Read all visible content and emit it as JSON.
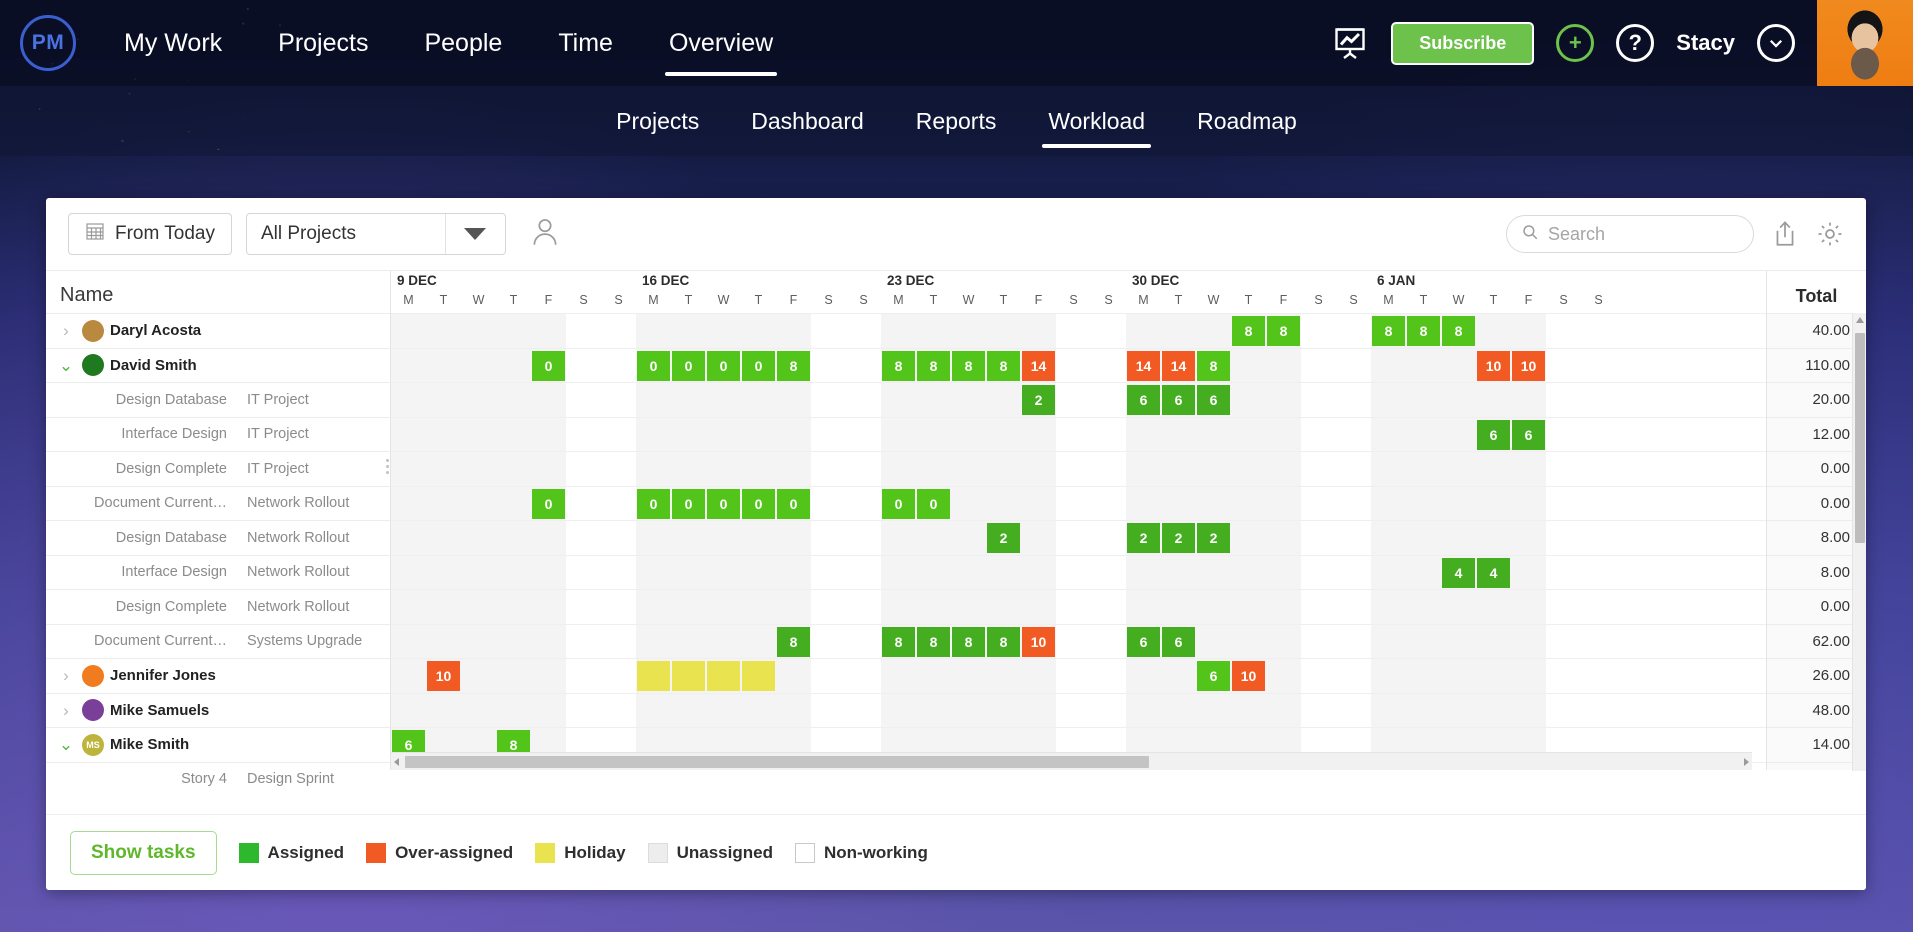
{
  "brand": {
    "logo_text": "PM"
  },
  "topnav": {
    "links": [
      {
        "label": "My Work",
        "active": false
      },
      {
        "label": "Projects",
        "active": false
      },
      {
        "label": "People",
        "active": false
      },
      {
        "label": "Time",
        "active": false
      },
      {
        "label": "Overview",
        "active": true
      }
    ],
    "presentation_icon": "presentation-chart-icon",
    "subscribe_label": "Subscribe",
    "add_icon": "plus-circle-icon",
    "help_icon": "question-circle-icon",
    "user_name": "Stacy",
    "user_caret_icon": "chevron-down-circle-icon",
    "avatar": "user-photo-avatar"
  },
  "subnav": {
    "tabs": [
      {
        "label": "Projects",
        "active": false
      },
      {
        "label": "Dashboard",
        "active": false
      },
      {
        "label": "Reports",
        "active": false
      },
      {
        "label": "Workload",
        "active": true
      },
      {
        "label": "Roadmap",
        "active": false
      }
    ]
  },
  "toolbar": {
    "date_button": "From Today",
    "date_icon": "calendar-icon",
    "project_filter_value": "All Projects",
    "person_filter_icon": "person-filter-icon",
    "search_placeholder": "Search",
    "search_value": "",
    "search_icon": "search-icon",
    "export_icon": "share-export-icon",
    "settings_icon": "gear-icon"
  },
  "grid": {
    "name_header": "Name",
    "total_header": "Total",
    "weeks": [
      {
        "label": "9 DEC",
        "days": [
          "M",
          "T",
          "W",
          "T",
          "F",
          "S",
          "S"
        ]
      },
      {
        "label": "16 DEC",
        "days": [
          "M",
          "T",
          "W",
          "T",
          "F",
          "S",
          "S"
        ]
      },
      {
        "label": "23 DEC",
        "days": [
          "M",
          "T",
          "W",
          "T",
          "F",
          "S",
          "S"
        ]
      },
      {
        "label": "30 DEC",
        "days": [
          "M",
          "T",
          "W",
          "T",
          "F",
          "S",
          "S"
        ]
      },
      {
        "label": "6 JAN",
        "days": [
          "M",
          "T",
          "W",
          "T",
          "F",
          "S",
          "S"
        ]
      }
    ],
    "day_width": 35,
    "rows": [
      {
        "type": "person",
        "name": "Daryl Acosta",
        "expanded": false,
        "avatar_color": "#b8893f",
        "total": "40.00",
        "cells": [
          {
            "d": 24,
            "v": "8",
            "k": "assigned"
          },
          {
            "d": 25,
            "v": "8",
            "k": "assigned"
          },
          {
            "d": 28,
            "v": "8",
            "k": "assigned"
          },
          {
            "d": 29,
            "v": "8",
            "k": "assigned"
          },
          {
            "d": 30,
            "v": "8",
            "k": "assigned"
          }
        ]
      },
      {
        "type": "person",
        "name": "David Smith",
        "expanded": true,
        "avatar_color": "#1f7a1f",
        "total": "110.00",
        "cells": [
          {
            "d": 4,
            "v": "0",
            "k": "assigned"
          },
          {
            "d": 7,
            "v": "0",
            "k": "assigned"
          },
          {
            "d": 8,
            "v": "0",
            "k": "assigned"
          },
          {
            "d": 9,
            "v": "0",
            "k": "assigned"
          },
          {
            "d": 10,
            "v": "0",
            "k": "assigned"
          },
          {
            "d": 11,
            "v": "8",
            "k": "assigned"
          },
          {
            "d": 14,
            "v": "8",
            "k": "assigned"
          },
          {
            "d": 15,
            "v": "8",
            "k": "assigned"
          },
          {
            "d": 16,
            "v": "8",
            "k": "assigned"
          },
          {
            "d": 17,
            "v": "8",
            "k": "assigned"
          },
          {
            "d": 18,
            "v": "14",
            "k": "over"
          },
          {
            "d": 21,
            "v": "14",
            "k": "over"
          },
          {
            "d": 22,
            "v": "14",
            "k": "over"
          },
          {
            "d": 23,
            "v": "8",
            "k": "assigned"
          },
          {
            "d": 31,
            "v": "10",
            "k": "over"
          },
          {
            "d": 32,
            "v": "10",
            "k": "over"
          }
        ]
      },
      {
        "type": "task",
        "name": "Design Database",
        "project": "IT Project",
        "total": "20.00",
        "cells": [
          {
            "d": 18,
            "v": "2",
            "k": "assigned-task"
          },
          {
            "d": 21,
            "v": "6",
            "k": "assigned-task"
          },
          {
            "d": 22,
            "v": "6",
            "k": "assigned-task"
          },
          {
            "d": 23,
            "v": "6",
            "k": "assigned-task"
          }
        ]
      },
      {
        "type": "task",
        "name": "Interface Design",
        "project": "IT Project",
        "total": "12.00",
        "cells": [
          {
            "d": 31,
            "v": "6",
            "k": "assigned-task"
          },
          {
            "d": 32,
            "v": "6",
            "k": "assigned-task"
          }
        ]
      },
      {
        "type": "task",
        "name": "Design Complete",
        "project": "IT Project",
        "total": "0.00",
        "cells": []
      },
      {
        "type": "task",
        "name": "Document Current…",
        "project": "Network Rollout",
        "total": "0.00",
        "cells": [
          {
            "d": 4,
            "v": "0",
            "k": "assigned"
          },
          {
            "d": 7,
            "v": "0",
            "k": "assigned"
          },
          {
            "d": 8,
            "v": "0",
            "k": "assigned"
          },
          {
            "d": 9,
            "v": "0",
            "k": "assigned"
          },
          {
            "d": 10,
            "v": "0",
            "k": "assigned"
          },
          {
            "d": 11,
            "v": "0",
            "k": "assigned"
          },
          {
            "d": 14,
            "v": "0",
            "k": "assigned"
          },
          {
            "d": 15,
            "v": "0",
            "k": "assigned"
          }
        ]
      },
      {
        "type": "task",
        "name": "Design Database",
        "project": "Network Rollout",
        "total": "8.00",
        "cells": [
          {
            "d": 17,
            "v": "2",
            "k": "assigned-task"
          },
          {
            "d": 21,
            "v": "2",
            "k": "assigned-task"
          },
          {
            "d": 22,
            "v": "2",
            "k": "assigned-task"
          },
          {
            "d": 23,
            "v": "2",
            "k": "assigned-task"
          }
        ]
      },
      {
        "type": "task",
        "name": "Interface Design",
        "project": "Network Rollout",
        "total": "8.00",
        "cells": [
          {
            "d": 30,
            "v": "4",
            "k": "assigned-task"
          },
          {
            "d": 31,
            "v": "4",
            "k": "assigned-task"
          }
        ]
      },
      {
        "type": "task",
        "name": "Design Complete",
        "project": "Network Rollout",
        "total": "0.00",
        "cells": []
      },
      {
        "type": "task",
        "name": "Document Current…",
        "project": "Systems Upgrade",
        "total": "62.00",
        "cells": [
          {
            "d": 11,
            "v": "8",
            "k": "assigned-task"
          },
          {
            "d": 14,
            "v": "8",
            "k": "assigned-task"
          },
          {
            "d": 15,
            "v": "8",
            "k": "assigned-task"
          },
          {
            "d": 16,
            "v": "8",
            "k": "assigned-task"
          },
          {
            "d": 17,
            "v": "8",
            "k": "assigned-task"
          },
          {
            "d": 18,
            "v": "10",
            "k": "over"
          },
          {
            "d": 21,
            "v": "6",
            "k": "assigned-task"
          },
          {
            "d": 22,
            "v": "6",
            "k": "assigned-task"
          }
        ]
      },
      {
        "type": "person",
        "name": "Jennifer Jones",
        "expanded": false,
        "avatar_color": "#f07c1f",
        "total": "26.00",
        "cells": [
          {
            "d": 1,
            "v": "10",
            "k": "over"
          },
          {
            "d": 7,
            "v": "",
            "k": "holiday"
          },
          {
            "d": 8,
            "v": "",
            "k": "holiday"
          },
          {
            "d": 9,
            "v": "",
            "k": "holiday"
          },
          {
            "d": 10,
            "v": "",
            "k": "holiday"
          },
          {
            "d": 23,
            "v": "6",
            "k": "assigned"
          },
          {
            "d": 24,
            "v": "10",
            "k": "over"
          }
        ]
      },
      {
        "type": "person",
        "name": "Mike Samuels",
        "expanded": false,
        "avatar_color": "#7a3f99",
        "total": "48.00",
        "cells": []
      },
      {
        "type": "person",
        "name": "Mike Smith",
        "expanded": true,
        "avatar_color": "#bdb43c",
        "initials": "MS",
        "total": "14.00",
        "cells": [
          {
            "d": 0,
            "v": "6",
            "k": "assigned"
          },
          {
            "d": 3,
            "v": "8",
            "k": "assigned"
          }
        ]
      },
      {
        "type": "task",
        "name": "Story 4",
        "project": "Design Sprint",
        "total": "",
        "cells": []
      }
    ]
  },
  "legend": {
    "show_tasks_label": "Show tasks",
    "items": [
      {
        "label": "Assigned",
        "key": "assigned"
      },
      {
        "label": "Over-assigned",
        "key": "over"
      },
      {
        "label": "Holiday",
        "key": "holiday"
      },
      {
        "label": "Unassigned",
        "key": "unassigned"
      },
      {
        "label": "Non-working",
        "key": "nonworking"
      }
    ]
  },
  "colors": {
    "assigned": "#52c41a",
    "assigned_task": "#45ae20",
    "over_assigned": "#f15a22",
    "holiday": "#e9e34f",
    "brand_green": "#6cc24a",
    "nav_dark": "#0a0e23"
  }
}
